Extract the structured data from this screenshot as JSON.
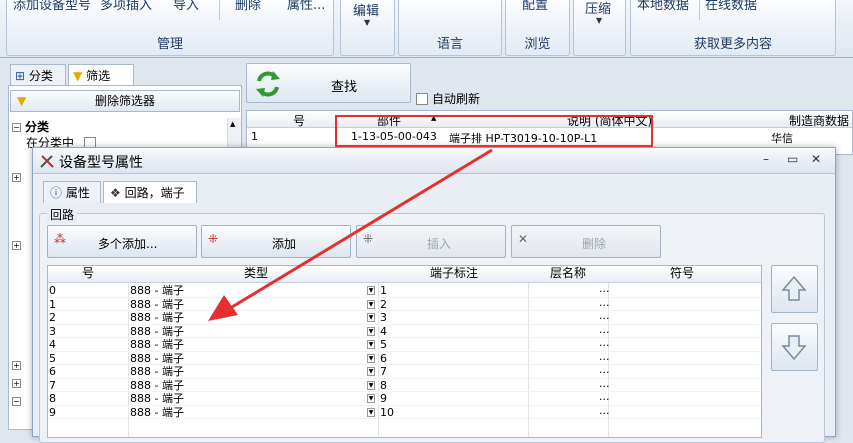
{
  "ribbon": {
    "buttons": [
      {
        "id": "add-model",
        "label": "添加设备型号"
      },
      {
        "id": "multi-insert",
        "label": "多项插入"
      },
      {
        "id": "import",
        "label": "导入"
      },
      {
        "id": "delete",
        "label": "删除"
      },
      {
        "id": "properties",
        "label": "属性..."
      },
      {
        "id": "edit",
        "label": "编辑"
      },
      {
        "id": "config",
        "label": "配置"
      },
      {
        "id": "compress",
        "label": "压缩"
      },
      {
        "id": "local-data",
        "label": "本地数据"
      },
      {
        "id": "online-data",
        "label": "在线数据"
      }
    ],
    "groups": [
      "管理",
      "语言",
      "浏览",
      "获取更多内容"
    ]
  },
  "left_panel": {
    "tabs": [
      "分类",
      "筛选"
    ],
    "clear_filter_label": "删除筛选器",
    "tree": [
      {
        "sign": "−",
        "label": "分类",
        "bold": true
      },
      {
        "sign": "",
        "label": "在分类中",
        "bold": false
      }
    ],
    "collapsed_tail": [
      "+",
      "+",
      "+",
      "+",
      "−"
    ]
  },
  "search": {
    "find_label": "查找",
    "auto_refresh_label": "自动刷新"
  },
  "result_grid": {
    "headers": [
      "号",
      "部件",
      "说明 (简体中文)",
      "制造商数据"
    ],
    "rows": [
      {
        "num": "1",
        "part": "1-13-05-00-043",
        "desc": "端子排 HP-T3019-10-10P-L1",
        "mfr": "华信"
      }
    ]
  },
  "dialog": {
    "title": "设备型号属性",
    "tabs": [
      "属性",
      "回路，端子"
    ],
    "group_label": "回路",
    "actions": [
      {
        "id": "multi-add",
        "label": "多个添加...",
        "enabled": true
      },
      {
        "id": "add",
        "label": "添加",
        "enabled": true
      },
      {
        "id": "insert",
        "label": "插入",
        "enabled": false
      },
      {
        "id": "remove",
        "label": "删除",
        "enabled": false
      }
    ],
    "grid_headers": [
      "号",
      "类型",
      "端子标注",
      "层名称",
      "符号"
    ],
    "rows": [
      {
        "num": "0",
        "type": "888 - 端子",
        "label": "1",
        "layer": "..."
      },
      {
        "num": "1",
        "type": "888 - 端子",
        "label": "2",
        "layer": "..."
      },
      {
        "num": "2",
        "type": "888 - 端子",
        "label": "3",
        "layer": "..."
      },
      {
        "num": "3",
        "type": "888 - 端子",
        "label": "4",
        "layer": "..."
      },
      {
        "num": "4",
        "type": "888 - 端子",
        "label": "5",
        "layer": "..."
      },
      {
        "num": "5",
        "type": "888 - 端子",
        "label": "6",
        "layer": "..."
      },
      {
        "num": "6",
        "type": "888 - 端子",
        "label": "7",
        "layer": "..."
      },
      {
        "num": "7",
        "type": "888 - 端子",
        "label": "8",
        "layer": "..."
      },
      {
        "num": "8",
        "type": "888 - 端子",
        "label": "9",
        "layer": "..."
      },
      {
        "num": "9",
        "type": "888 - 端子",
        "label": "10",
        "layer": "..."
      }
    ]
  },
  "colors": {
    "annotation": "#e53030",
    "accent": "#1f3b63"
  }
}
